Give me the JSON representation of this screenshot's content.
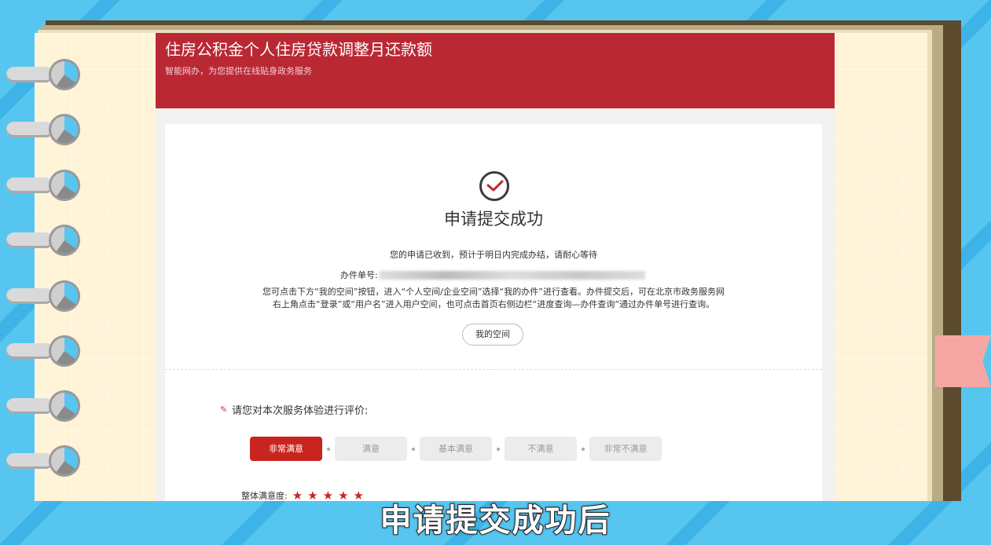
{
  "header": {
    "title": "住房公积金个人住房贷款调整月还款额",
    "subtitle": "智能网办，为您提供在线贴身政务服务"
  },
  "result": {
    "title": "申请提交成功",
    "received_msg": "您的申请已收到，预计于明日内完成办结，请耐心等待",
    "order_label": "办件单号:",
    "instruction_line1": "您可点击下方“我的空间”按钮，进入“个人空间/企业空间”选择“我的办件”进行查看。办件提交后，可在北京市政务服务网",
    "instruction_line2": "右上角点击“登录”或“用户名”进入用户空间，也可点击首页右侧边栏“进度查询—办件查询”通过办件单号进行查询。",
    "my_space_button": "我的空间"
  },
  "evaluation": {
    "prompt": "请您对本次服务体验进行评价:",
    "options": [
      "非常满意",
      "满意",
      "基本满意",
      "不满意",
      "非常不满意"
    ],
    "selected_option": "非常满意",
    "overall_label": "整体满意度:",
    "stars": 5
  },
  "caption": "申请提交成功后",
  "colors": {
    "header_red": "#ba2834",
    "selected_button": "#c9251f",
    "star": "#c0272d",
    "background_blue": "#56c6f0"
  }
}
